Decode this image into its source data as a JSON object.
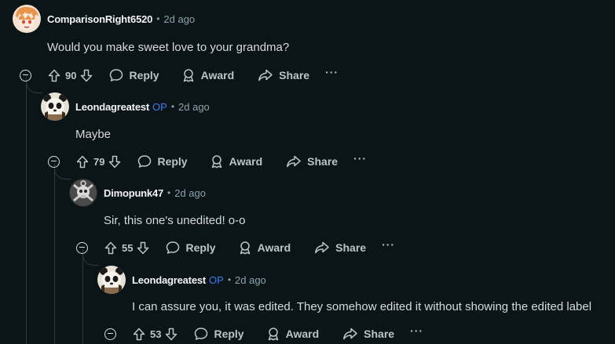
{
  "comments": [
    {
      "author": "ComparisonRight6520",
      "op": "",
      "time": "2d ago",
      "text": "Would you make sweet love to your grandma?",
      "score": "90",
      "avatar": "anime-avatar"
    },
    {
      "author": "Leondagreatest",
      "op": "OP",
      "time": "2d ago",
      "text": "Maybe",
      "score": "79",
      "avatar": "panda-avatar"
    },
    {
      "author": "Dimopunk47",
      "op": "",
      "time": "2d ago",
      "text": "Sir, this one's unedited! o-o",
      "score": "55",
      "avatar": "skull-avatar"
    },
    {
      "author": "Leondagreatest",
      "op": "OP",
      "time": "2d ago",
      "text": "I can assure you, it was edited. They somehow edited it without showing the edited label",
      "score": "53",
      "avatar": "panda-avatar"
    }
  ],
  "labels": {
    "reply": "Reply",
    "award": "Award",
    "share": "Share",
    "dot": "•",
    "more": "···"
  },
  "colors": {
    "background": "#0b1416",
    "op_badge": "#3d7cf2",
    "text": "#d7dadc",
    "muted": "#8ba2ad"
  }
}
